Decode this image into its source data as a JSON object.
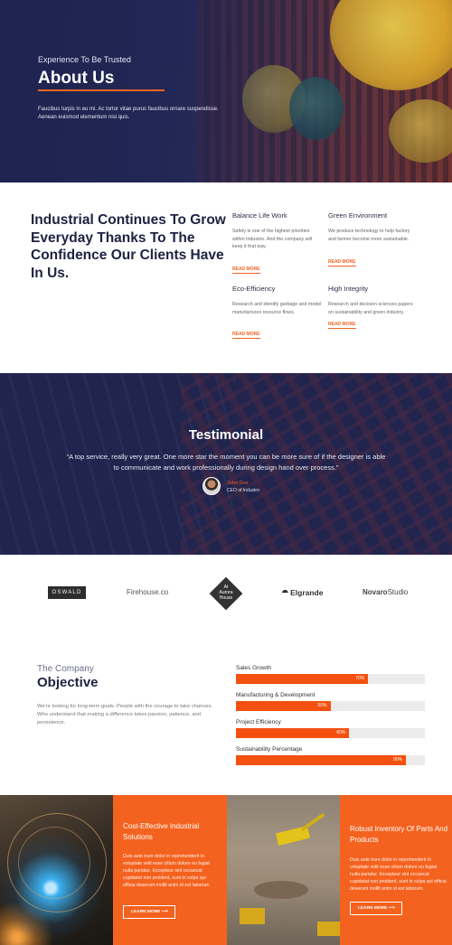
{
  "hero": {
    "kicker": "Experience To Be Trusted",
    "title": "About Us",
    "description": "Faucibus turpis in eu mi. Ac tortor vitae purus faucibus ornare suspendisse. Aenean euismod elementum nisi quis."
  },
  "about": {
    "headline": "Industrial Continues To Grow Everyday Thanks To The Confidence Our Clients Have In Us.",
    "features": [
      {
        "title": "Balance Life Work",
        "text": "Safety is one of the highest priorities within Industrio. And the company will keep it that way.",
        "link": "READ MORE"
      },
      {
        "title": "Green Environment",
        "text": "We produce technology to help factory and farmer become more sustainable.",
        "link": "READ MORE"
      },
      {
        "title": "Eco-Efficiency",
        "text": "Research and identify garbage and model manufactures resource flows.",
        "link": "READ MORE"
      },
      {
        "title": "High Integrity",
        "text": "Research and decision sciences papers on sustainability and green industry.",
        "link": "READ MORE"
      }
    ]
  },
  "testimonial": {
    "title": "Testimonial",
    "quote": "“A top service, really very great. One more star the moment you can be more sure of if the designer is able to communicate and work professionally during design hand over process.”",
    "name": "John Doe",
    "role": "CEO of Industro"
  },
  "logos": {
    "oswald": "OSWALD",
    "firehouse": "Firehouse.co",
    "aurora": [
      "At",
      "Aurora",
      "House"
    ],
    "elgrande": "Elgrande",
    "novaro_bold": "Novaro",
    "novaro_light": "Studio"
  },
  "objective": {
    "kicker": "The Company",
    "title": "Objective",
    "description": "We're looking for long-term goals. People with the courage to take chances. Who understand that making a difference takes passion, patience, and persistence.",
    "skills": [
      {
        "label": "Sales Growth",
        "percent": 70,
        "text": "70%"
      },
      {
        "label": "Manufacturing & Development",
        "percent": 50,
        "text": "50%"
      },
      {
        "label": "Project Efficiency",
        "percent": 60,
        "text": "60%"
      },
      {
        "label": "Sustainability Percentage",
        "percent": 90,
        "text": "90%"
      }
    ]
  },
  "services": [
    {
      "title": "Cost-Effective Industrial Solutions",
      "text": "Duis aute irure dolor in reprehenderit in voluptate velit esse cillum dolore eu fugiat nulla pariatur. Excepteur sint occaecat cupidatat non proident, sunt in culpa qui officia deserunt mollit anim id est laborum.",
      "button": "LEARN MORE ⟶"
    },
    {
      "title": "Robust Inventory Of Parts And Products",
      "text": "Duis aute irure dolor in reprehenderit in voluptate velit esse cillum dolore eu fugiat nulla pariatur. Excepteur sint occaecat cupidatat non proident, sunt in culpa qui officia deserunt mollit anim id est laborum.",
      "button": "LEARN MORE ⟶"
    }
  ],
  "colors": {
    "accent": "#f26422",
    "navy": "#1e2140",
    "orange_tile": "#f4621f"
  }
}
